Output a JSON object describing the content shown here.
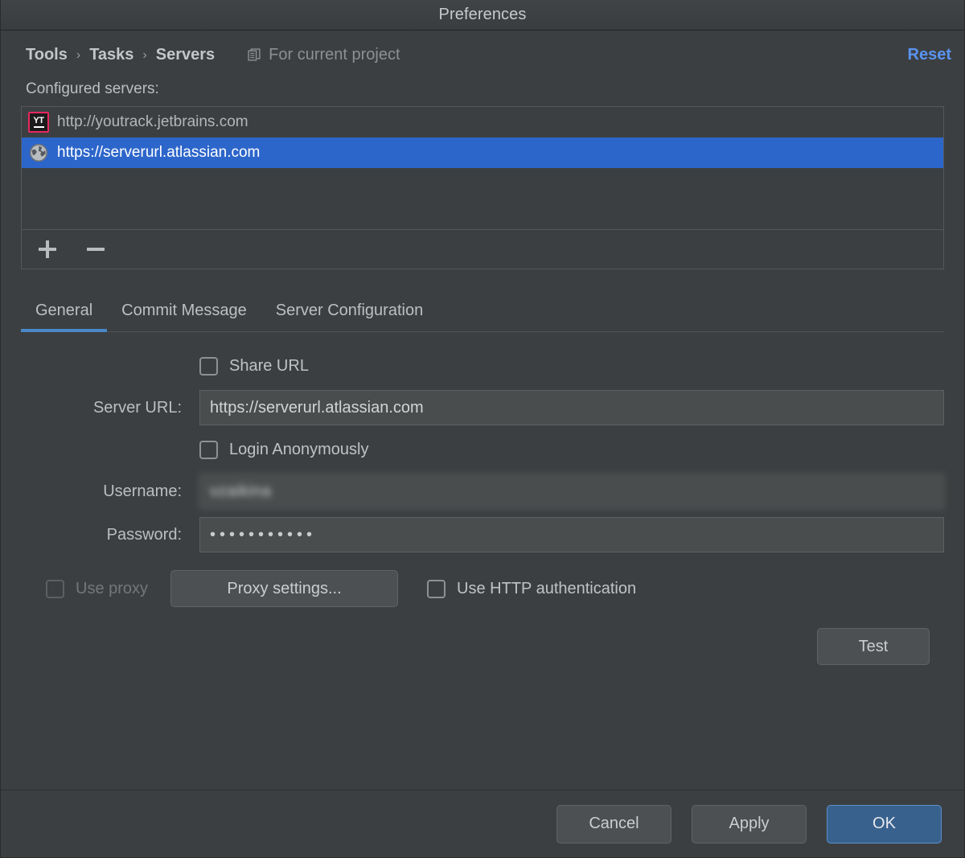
{
  "window": {
    "title": "Preferences"
  },
  "breadcrumb": {
    "items": [
      "Tools",
      "Tasks",
      "Servers"
    ],
    "separator": "›",
    "scope_label": "For current project",
    "scope_icon": "project-scope-icon",
    "reset_label": "Reset",
    "reset_color": "#5a93f0"
  },
  "servers_section": {
    "label": "Configured servers:",
    "rows": [
      {
        "icon": "youtrack-icon",
        "url": "http://youtrack.jetbrains.com",
        "selected": false
      },
      {
        "icon": "globe-icon",
        "url": "https://serverurl.atlassian.com",
        "selected": true
      }
    ],
    "toolbar": {
      "add_icon": "plus-icon",
      "remove_icon": "minus-icon"
    },
    "selection_color": "#2d66cb"
  },
  "tabs": [
    {
      "label": "General",
      "active": true
    },
    {
      "label": "Commit Message",
      "active": false
    },
    {
      "label": "Server Configuration",
      "active": false
    }
  ],
  "tab_accent_color": "#4a88c7",
  "general_tab": {
    "share_url": {
      "label": "Share URL",
      "checked": false
    },
    "server_url": {
      "label": "Server URL:",
      "value": "https://serverurl.atlassian.com"
    },
    "login_anonymously": {
      "label": "Login Anonymously",
      "checked": false
    },
    "username": {
      "label": "Username:",
      "value": "vzaikina"
    },
    "password": {
      "label": "Password:",
      "value": "•••••••••••"
    },
    "use_proxy": {
      "label": "Use proxy",
      "checked": false,
      "disabled": true
    },
    "proxy_settings_button": "Proxy settings...",
    "use_http_auth": {
      "label": "Use HTTP authentication",
      "checked": false
    },
    "test_button": "Test"
  },
  "footer": {
    "cancel_label": "Cancel",
    "apply_label": "Apply",
    "ok_label": "OK",
    "ok_color": "#38618e"
  }
}
